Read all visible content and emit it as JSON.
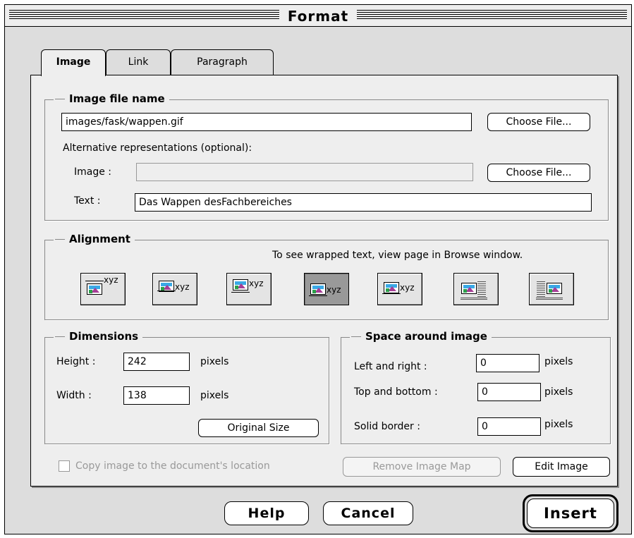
{
  "window": {
    "title": "Format"
  },
  "tabs": [
    {
      "label": "Image"
    },
    {
      "label": "Link"
    },
    {
      "label": "Paragraph"
    }
  ],
  "image_file": {
    "legend": "Image file name",
    "path_value": "images/fask/wappen.gif",
    "choose_file_label": "Choose File...",
    "alt_label": "Alternative representations (optional):",
    "alt_image_label": "Image :",
    "alt_image_value": "",
    "alt_choose_file_label": "Choose File...",
    "alt_text_label": "Text :",
    "alt_text_value": "Das Wappen desFachbereiches"
  },
  "alignment": {
    "legend": "Alignment",
    "hint": "To see wrapped text, view page in Browse window.",
    "sample_text": "xyz",
    "options": [
      "top",
      "absmiddle",
      "middle",
      "bottom",
      "baseline",
      "left",
      "right"
    ],
    "selected_index": 3
  },
  "dimensions": {
    "legend": "Dimensions",
    "height_label": "Height :",
    "height_value": "242",
    "width_label": "Width :",
    "width_value": "138",
    "unit": "pixels",
    "original_size_label": "Original Size"
  },
  "space": {
    "legend": "Space around image",
    "left_right_label": "Left and right :",
    "left_right_value": "0",
    "top_bottom_label": "Top and bottom :",
    "top_bottom_value": "0",
    "border_label": "Solid border :",
    "border_value": "0",
    "unit": "pixels"
  },
  "copy_image": {
    "label": "Copy image to the document's location",
    "checked": false
  },
  "buttons": {
    "remove_image_map": "Remove Image Map",
    "edit_image": "Edit Image",
    "help": "Help",
    "cancel": "Cancel",
    "insert": "Insert"
  }
}
